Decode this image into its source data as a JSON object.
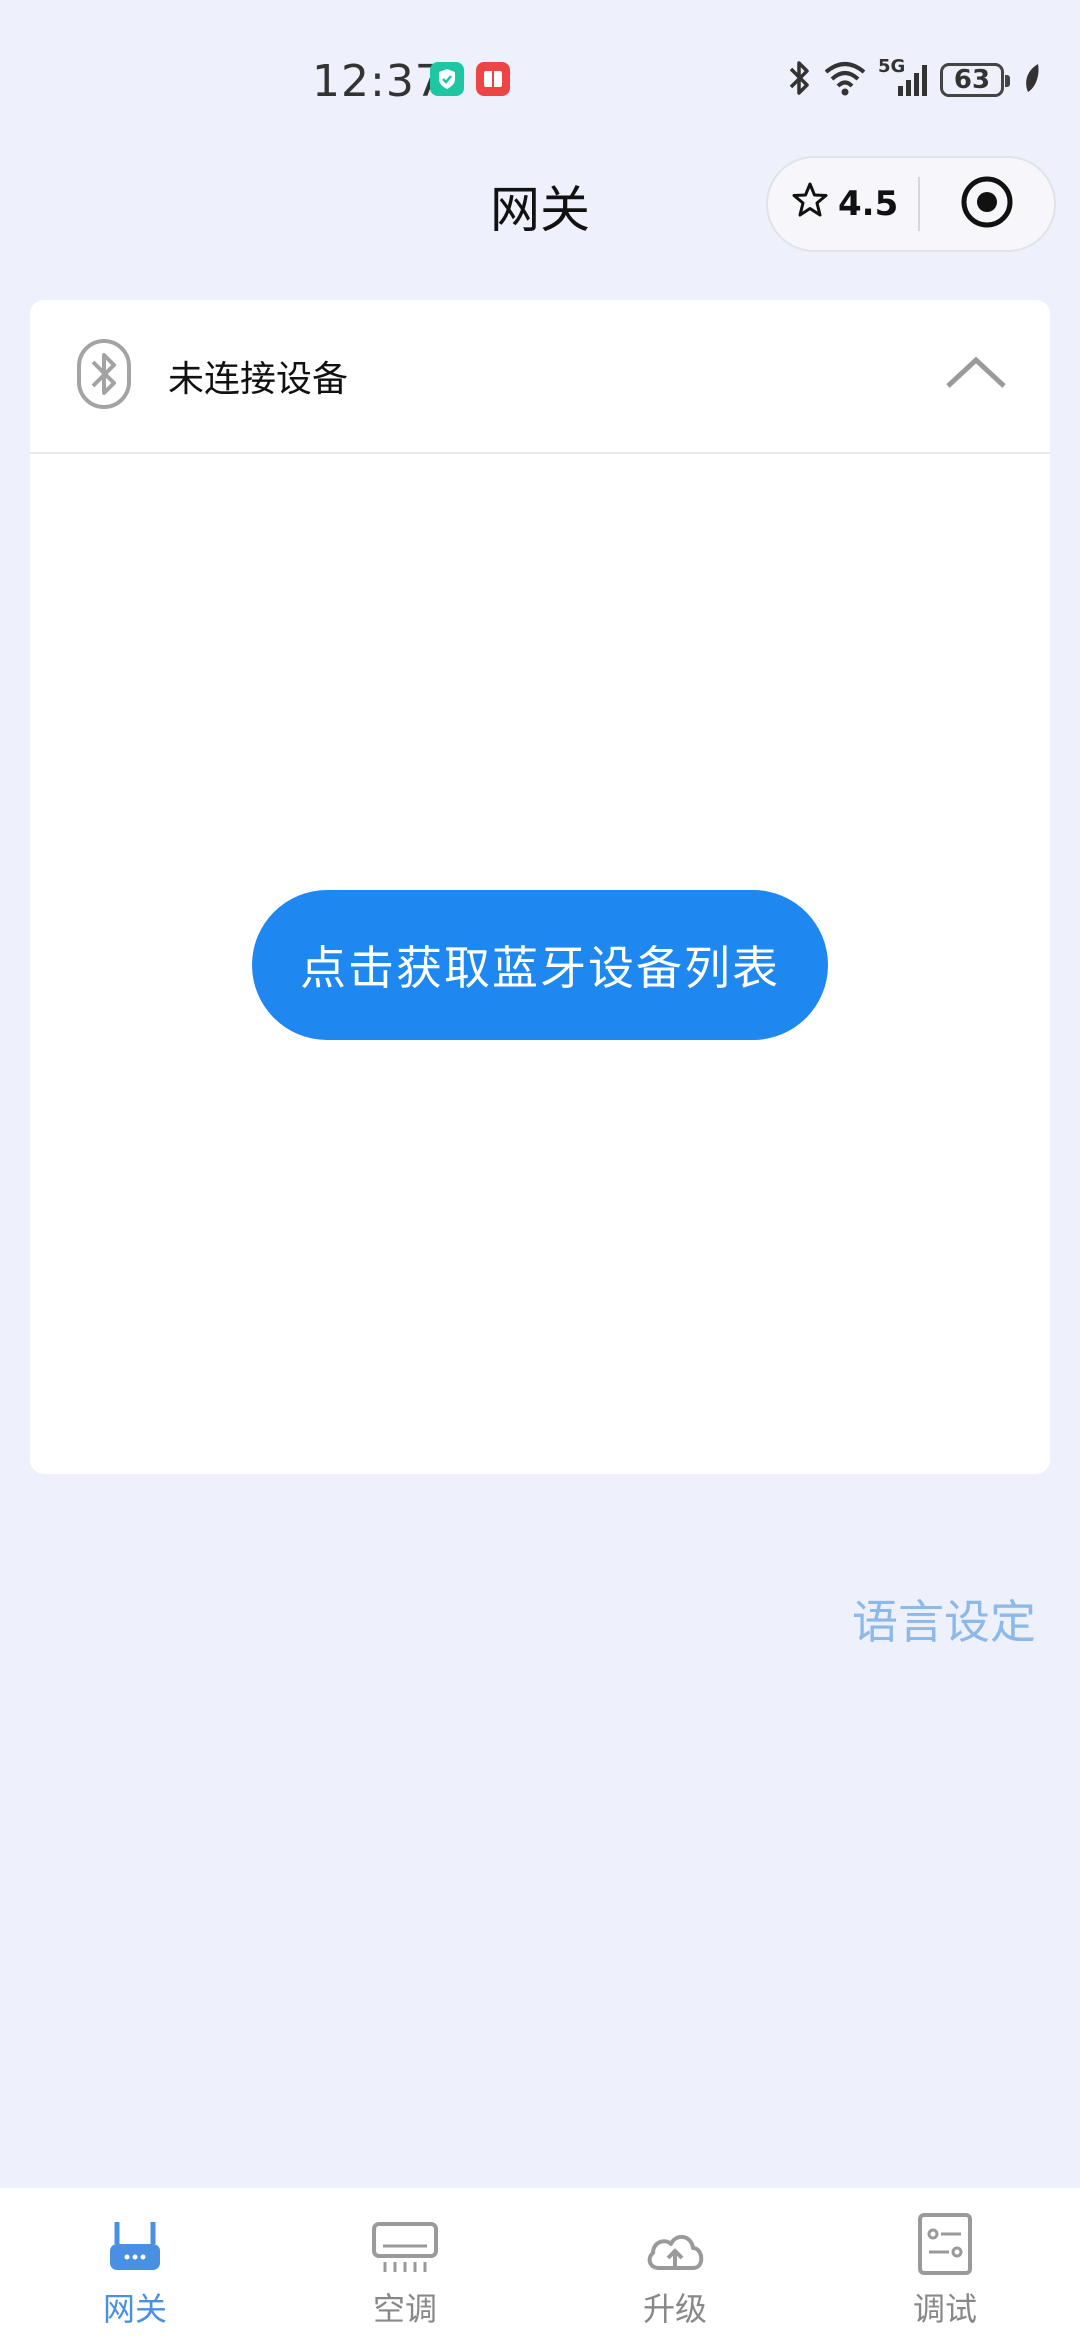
{
  "status_bar": {
    "time": "12:37",
    "network_label": "5G",
    "battery_level": "63",
    "icons": [
      "shield-app-icon",
      "book-app-icon",
      "bluetooth-icon",
      "wifi-icon",
      "signal-icon",
      "battery-icon",
      "leaf-icon"
    ],
    "colors": {
      "shield_badge": "#1ec6a4",
      "book_badge": "#ef4444"
    }
  },
  "header": {
    "title": "网关",
    "capsule": {
      "rating": "4.5",
      "icons": [
        "star-icon",
        "target-icon"
      ]
    }
  },
  "card": {
    "header_label": "未连接设备",
    "icons": [
      "bluetooth-icon",
      "chevron-up-icon"
    ],
    "get_devices_button": "点击获取蓝牙设备列表"
  },
  "language_link": "语言设定",
  "tabs": [
    {
      "label": "网关",
      "icon": "router-icon",
      "active": true
    },
    {
      "label": "空调",
      "icon": "air-conditioner-icon",
      "active": false
    },
    {
      "label": "升级",
      "icon": "cloud-upload-icon",
      "active": false
    },
    {
      "label": "调试",
      "icon": "settings-list-icon",
      "active": false
    }
  ],
  "colors": {
    "accent": "#1e88f0",
    "tab_active": "#4a90e2",
    "link": "#8ab9ea",
    "background": "#eef0fb"
  }
}
